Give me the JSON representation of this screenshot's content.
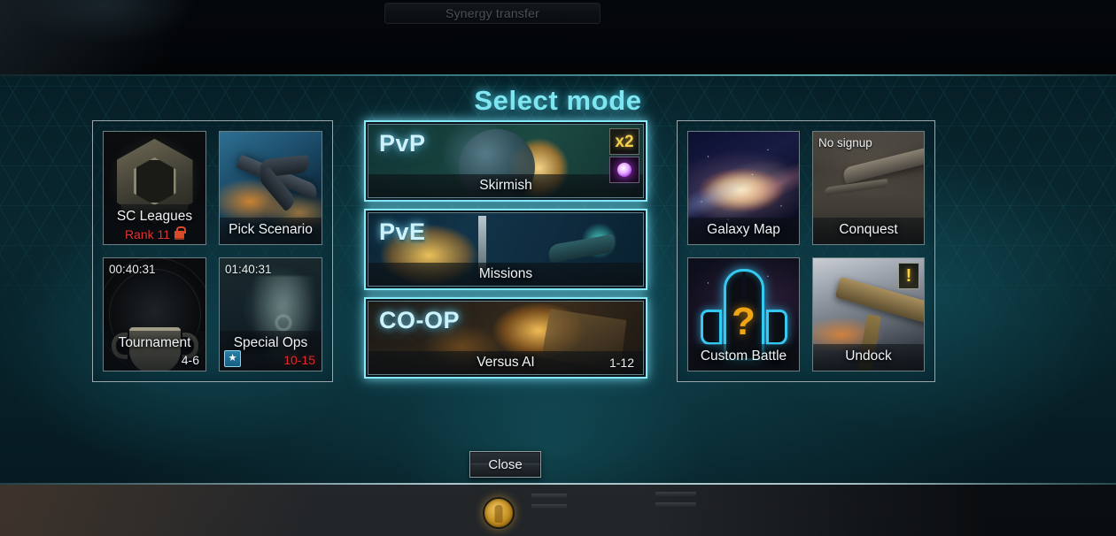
{
  "top_bar": {
    "synergy_transfer_label": "Synergy transfer"
  },
  "dialog": {
    "title": "Select mode",
    "close_label": "Close"
  },
  "left_panel": {
    "cards": [
      {
        "id": "sc-leagues",
        "label": "SC Leagues",
        "sub": "Rank 11",
        "locked": true,
        "corner_tl": "",
        "corner_br": ""
      },
      {
        "id": "pick-scenario",
        "label": "Pick Scenario",
        "sub": "",
        "locked": false,
        "corner_tl": "",
        "corner_br": ""
      },
      {
        "id": "tournament",
        "label": "Tournament",
        "sub": "",
        "locked": false,
        "corner_tl": "00:40:31",
        "corner_br": "4-6"
      },
      {
        "id": "special-ops",
        "label": "Special Ops",
        "sub": "",
        "locked": false,
        "corner_tl": "01:40:31",
        "corner_br": "10-15",
        "corner_br_red": true,
        "badge": "star"
      }
    ]
  },
  "center_panel": {
    "cards": [
      {
        "id": "pvp",
        "mode": "PvP",
        "name": "Skirmish",
        "range": "",
        "active": true,
        "multiplier_badge": "x2",
        "bonus_icon": "purple-orb-icon"
      },
      {
        "id": "pve",
        "mode": "PvE",
        "name": "Missions",
        "range": "",
        "active": true
      },
      {
        "id": "coop",
        "mode": "CO-OP",
        "name": "Versus AI",
        "range": "1-12",
        "active": true
      }
    ]
  },
  "right_panel": {
    "cards": [
      {
        "id": "galaxy-map",
        "label": "Galaxy Map",
        "corner_tl": "",
        "corner_br": ""
      },
      {
        "id": "conquest",
        "label": "Conquest",
        "corner_tl": "No signup",
        "corner_br": ""
      },
      {
        "id": "custom-battle",
        "label": "Custom Battle",
        "corner_tl": "",
        "corner_br": ""
      },
      {
        "id": "undock",
        "label": "Undock",
        "corner_tl": "",
        "corner_br": "",
        "badge": "warning"
      }
    ]
  },
  "colors": {
    "title_cyan": "#7fe6f2",
    "active_border": "#86e9f7",
    "alert_red": "#e53232",
    "badge_gold": "#f3cf52",
    "warning_yellow": "#ffd23a",
    "panel_border": "#9aa8ad"
  }
}
